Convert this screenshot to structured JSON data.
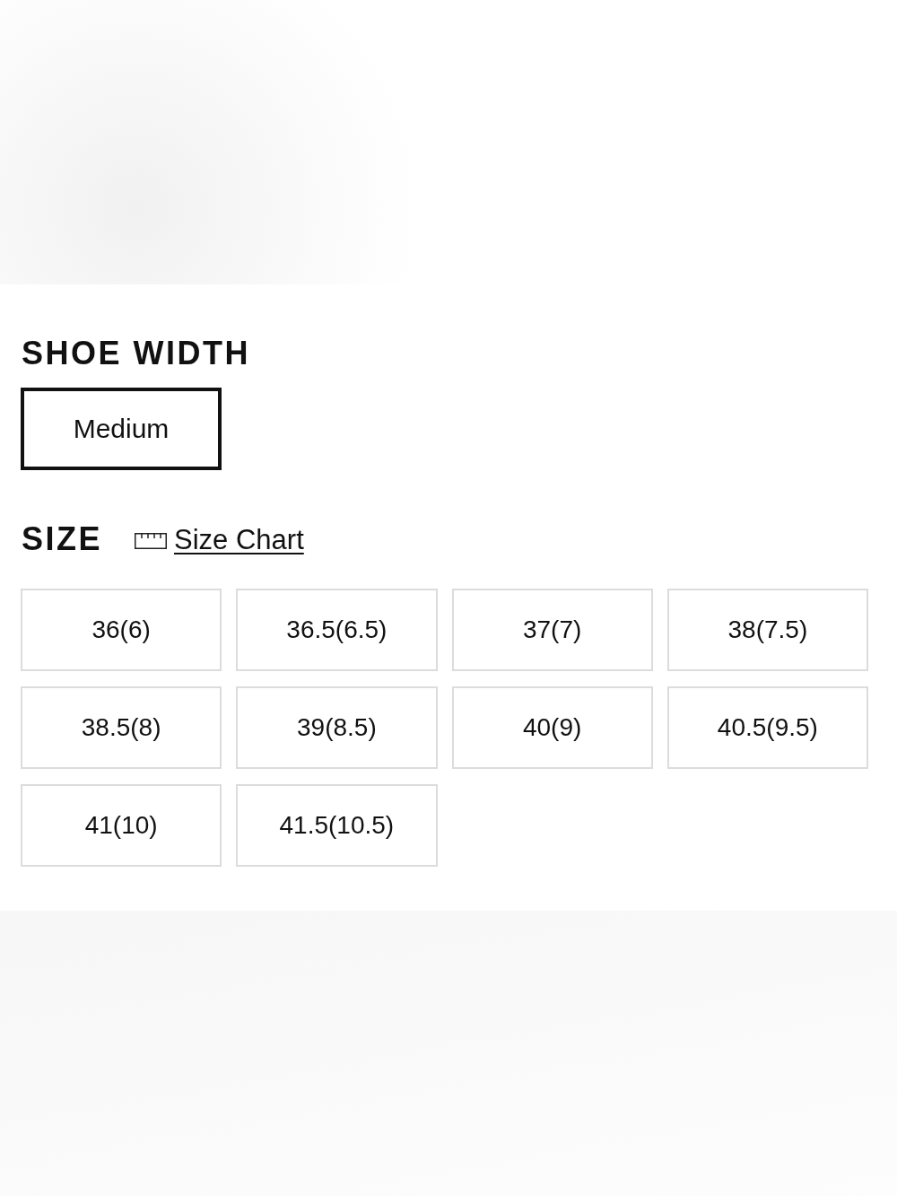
{
  "shoe_width": {
    "heading": "SHOE WIDTH",
    "options": [
      {
        "label": "Medium",
        "selected": true
      }
    ]
  },
  "size": {
    "heading": "SIZE",
    "size_chart_link": "Size Chart",
    "options": [
      {
        "label": "36(6)",
        "selected": false
      },
      {
        "label": "36.5(6.5)",
        "selected": false
      },
      {
        "label": "37(7)",
        "selected": false
      },
      {
        "label": "38(7.5)",
        "selected": false
      },
      {
        "label": "38.5(8)",
        "selected": false
      },
      {
        "label": "39(8.5)",
        "selected": false
      },
      {
        "label": "40(9)",
        "selected": false
      },
      {
        "label": "40.5(9.5)",
        "selected": false
      },
      {
        "label": "41(10)",
        "selected": false
      },
      {
        "label": "41.5(10.5)",
        "selected": false
      }
    ]
  }
}
